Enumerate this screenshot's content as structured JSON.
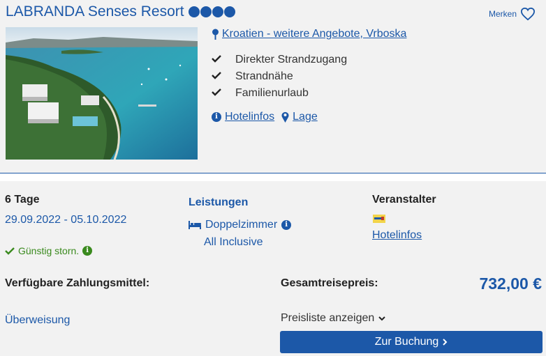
{
  "hotel": {
    "name": "LABRANDA Senses Resort",
    "star_count": 4,
    "merken_label": "Merken",
    "location_text": "Kroatien - weitere Angebote, Vrboska",
    "features": [
      "Direkter Strandzugang",
      "Strandnähe",
      "Familienurlaub"
    ],
    "links": {
      "hotelinfos": "Hotelinfos",
      "lage": "Lage"
    }
  },
  "offer": {
    "duration": "6 Tage",
    "dates": "29.09.2022 - 05.10.2022",
    "storno": "Günstig storn.",
    "leistungen_title": "Leistungen",
    "room": "Doppelzimmer",
    "board": "All Inclusive",
    "veranstalter_title": "Veranstalter",
    "veranstalter_link": "Hotelinfos",
    "zahlungsmittel_title": "Verfügbare Zahlungsmittel:",
    "zahlungsmittel": "Überweisung",
    "gesamtpreis_label": "Gesamtreisepreis:",
    "price": "732,00 €",
    "preisliste_label": "Preisliste anzeigen",
    "booking_button": "Zur Buchung"
  },
  "colors": {
    "brand_blue": "#1c58a8",
    "success_green": "#3a8a1e",
    "panel_bg": "#f2f2f2"
  },
  "icons": [
    "heart-icon",
    "map-pin-icon",
    "check-icon",
    "info-icon",
    "bed-icon",
    "chevron-down-icon",
    "chevron-right-icon"
  ]
}
